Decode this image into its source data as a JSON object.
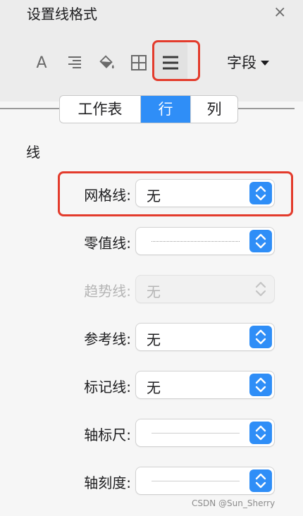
{
  "panel": {
    "title": "设置线格式",
    "close_glyph": "×"
  },
  "toolbar": {
    "text_glyph": "A",
    "field_label": "字段"
  },
  "tabs": [
    {
      "label": "工作表",
      "active": false
    },
    {
      "label": "行",
      "active": true
    },
    {
      "label": "列",
      "active": false
    }
  ],
  "section": {
    "title": "线"
  },
  "rows": {
    "grid": {
      "label": "网格线:",
      "value": "无"
    },
    "zero": {
      "label": "零值线:",
      "value": ""
    },
    "trend": {
      "label": "趋势线:",
      "value": "无"
    },
    "ref": {
      "label": "参考线:",
      "value": "无"
    },
    "drop": {
      "label": "标记线:",
      "value": "无"
    },
    "axis": {
      "label": "轴标尺:",
      "value": ""
    },
    "ticks": {
      "label": "轴刻度:",
      "value": ""
    }
  },
  "watermark": "CSDN @Sun_Sherry",
  "colors": {
    "accent": "#2f8ef7",
    "highlight": "#e33b2c"
  }
}
